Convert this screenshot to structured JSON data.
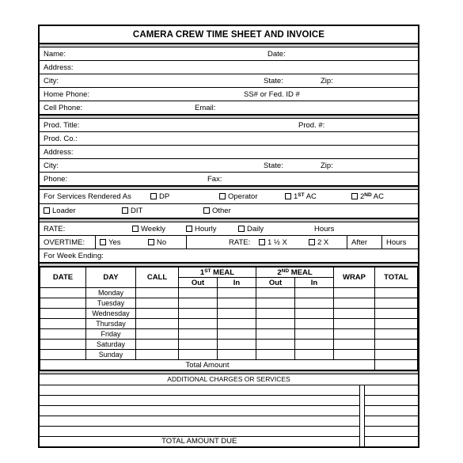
{
  "document": {
    "title": "CAMERA CREW TIME SHEET AND INVOICE"
  },
  "talent_info": {
    "name_label": "Name:",
    "date_label": "Date:",
    "address_label": "Address:",
    "city_label": "City:",
    "state_label": "State:",
    "zip_label": "Zip:",
    "home_phone_label": "Home Phone:",
    "ssn_label": "SS# or Fed. ID #",
    "cell_phone_label": "Cell Phone:",
    "email_label": "Email:"
  },
  "production_info": {
    "prod_title_label": "Prod. Title:",
    "prod_number_label": "Prod. #:",
    "prod_co_label": "Prod. Co.:",
    "address_label": "Address:",
    "city_label": "City:",
    "state_label": "State:",
    "zip_label": "Zip:",
    "phone_label": "Phone:",
    "fax_label": "Fax:"
  },
  "services": {
    "heading": "For Services Rendered As",
    "options_row1": [
      "DP",
      "Operator",
      "1ST AC",
      "2ND AC"
    ],
    "options_row2": [
      "Loader",
      "DIT",
      "Other"
    ],
    "dp": "DP",
    "operator": "Operator",
    "ac1_num": "1",
    "ac1_sup": "ST",
    "ac1_text": " AC",
    "ac2_num": "2",
    "ac2_sup": "ND",
    "ac2_text": " AC",
    "loader": "Loader",
    "dit": "DIT",
    "other": "Other"
  },
  "rate": {
    "rate_label": "RATE:",
    "weekly": "Weekly",
    "hourly": "Hourly",
    "daily": "Daily",
    "hours": "Hours",
    "overtime_label": "OVERTIME:",
    "yes": "Yes",
    "no": "No",
    "ot_rate_label": "RATE:",
    "one_half_x": "1 ½ X",
    "two_x": "2 X",
    "after": "After",
    "ot_hours": "Hours",
    "week_ending_label": "For Week Ending:"
  },
  "timesheet": {
    "headers": {
      "date": "DATE",
      "day": "DAY",
      "call": "CALL",
      "meal1": "MEAL",
      "meal1_num": "1",
      "meal1_sup": "ST",
      "meal2": "MEAL",
      "meal2_num": "2",
      "meal2_sup": "ND",
      "out": "Out",
      "in": "In",
      "wrap": "WRAP",
      "total": "TOTAL"
    },
    "rows": [
      {
        "date": "",
        "day": "Monday",
        "call": "",
        "m1_out": "",
        "m1_in": "",
        "m2_out": "",
        "m2_in": "",
        "wrap": "",
        "total": ""
      },
      {
        "date": "",
        "day": "Tuesday",
        "call": "",
        "m1_out": "",
        "m1_in": "",
        "m2_out": "",
        "m2_in": "",
        "wrap": "",
        "total": ""
      },
      {
        "date": "",
        "day": "Wednesday",
        "call": "",
        "m1_out": "",
        "m1_in": "",
        "m2_out": "",
        "m2_in": "",
        "wrap": "",
        "total": ""
      },
      {
        "date": "",
        "day": "Thursday",
        "call": "",
        "m1_out": "",
        "m1_in": "",
        "m2_out": "",
        "m2_in": "",
        "wrap": "",
        "total": ""
      },
      {
        "date": "",
        "day": "Friday",
        "call": "",
        "m1_out": "",
        "m1_in": "",
        "m2_out": "",
        "m2_in": "",
        "wrap": "",
        "total": ""
      },
      {
        "date": "",
        "day": "Saturday",
        "call": "",
        "m1_out": "",
        "m1_in": "",
        "m2_out": "",
        "m2_in": "",
        "wrap": "",
        "total": ""
      },
      {
        "date": "",
        "day": "Sunday",
        "call": "",
        "m1_out": "",
        "m1_in": "",
        "m2_out": "",
        "m2_in": "",
        "wrap": "",
        "total": ""
      }
    ],
    "total_amount_label": "Total Amount",
    "total_amount_value": ""
  },
  "additional": {
    "heading": "ADDITIONAL CHARGES OR SERVICES",
    "lines": [
      {
        "description": "",
        "amount": ""
      },
      {
        "description": "",
        "amount": ""
      },
      {
        "description": "",
        "amount": ""
      },
      {
        "description": "",
        "amount": ""
      },
      {
        "description": "",
        "amount": ""
      }
    ],
    "total_due_label": "TOTAL AMOUNT DUE",
    "total_due_value": ""
  },
  "colors": {
    "border": "#000000",
    "band": "#c9c9c9",
    "paper": "#ffffff"
  }
}
